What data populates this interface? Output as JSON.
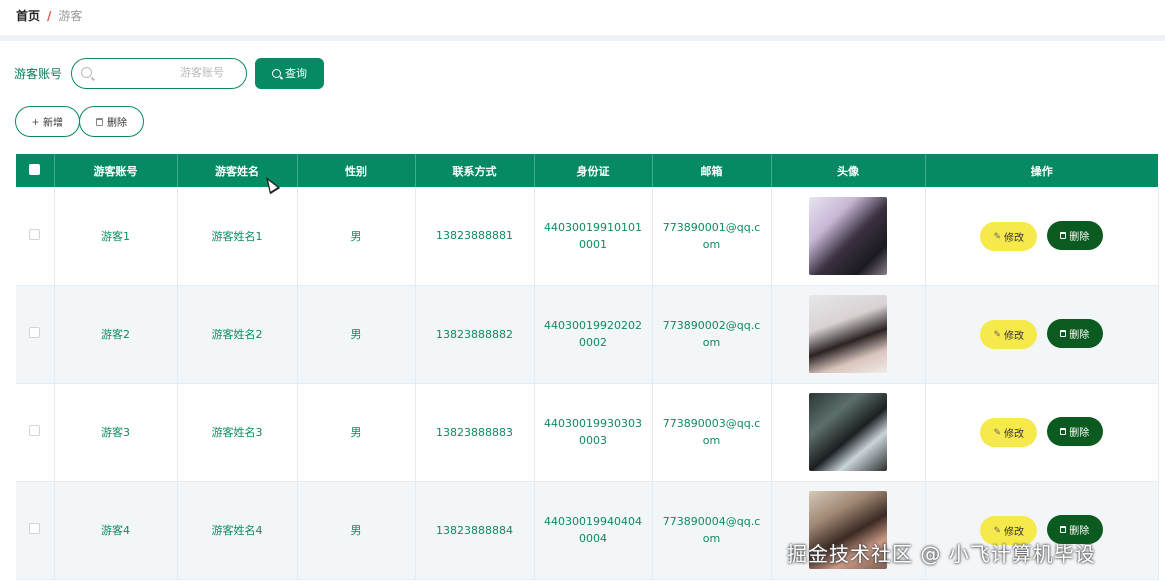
{
  "breadcrumb": {
    "home": "首页",
    "separator": "/",
    "current": "游客"
  },
  "search": {
    "label": "游客账号",
    "placeholder": "游客账号",
    "value": "",
    "button_label": "查询"
  },
  "actions": {
    "add_label": "新增",
    "delete_label": "删除"
  },
  "table": {
    "headers": [
      "游客账号",
      "游客姓名",
      "性别",
      "联系方式",
      "身份证",
      "邮箱",
      "头像",
      "操作"
    ],
    "rows": [
      {
        "account": "游客1",
        "name": "游客姓名1",
        "gender": "男",
        "phone": "13823888881",
        "id_card": "440300199101010001",
        "email": "773890001@qq.com"
      },
      {
        "account": "游客2",
        "name": "游客姓名2",
        "gender": "男",
        "phone": "13823888882",
        "id_card": "440300199202020002",
        "email": "773890002@qq.com"
      },
      {
        "account": "游客3",
        "name": "游客姓名3",
        "gender": "男",
        "phone": "13823888883",
        "id_card": "440300199303030003",
        "email": "773890003@qq.com"
      },
      {
        "account": "游客4",
        "name": "游客姓名4",
        "gender": "男",
        "phone": "13823888884",
        "id_card": "440300199404040004",
        "email": "773890004@qq.com"
      }
    ],
    "row_actions": {
      "edit_label": "修改",
      "delete_label": "删除"
    }
  },
  "watermark": "掘金技术社区 @ 小飞计算机毕设",
  "colors": {
    "primary": "#068a63",
    "edit": "#f6e94b",
    "danger": "#0b5a1f",
    "text_green": "#0d8a63"
  },
  "icons": [
    "search-icon",
    "plus-icon",
    "trash-icon",
    "pen-icon"
  ]
}
